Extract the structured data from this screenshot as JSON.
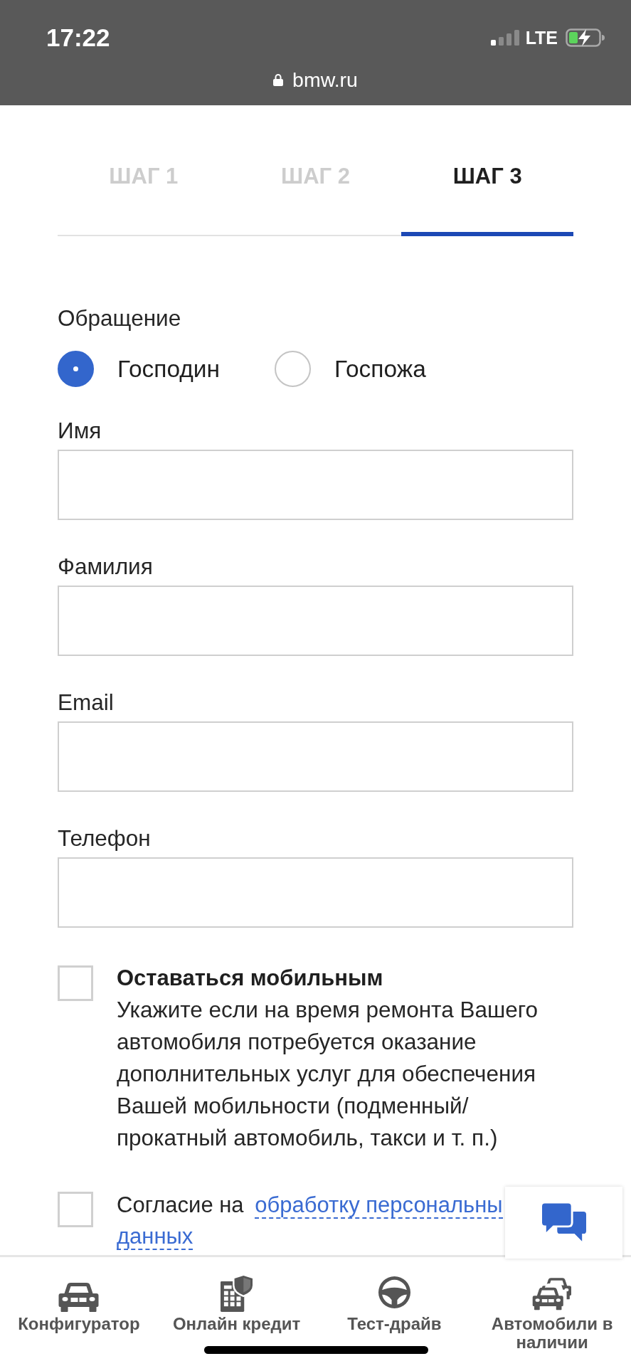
{
  "status_bar": {
    "time": "17:22",
    "network": "LTE"
  },
  "address_bar": {
    "url": "bmw.ru"
  },
  "steps": [
    {
      "label": "ШАГ 1",
      "selected": false
    },
    {
      "label": "ШАГ 2",
      "selected": false
    },
    {
      "label": "ШАГ 3",
      "selected": true
    }
  ],
  "salutation": {
    "label": "Обращение",
    "options": [
      {
        "label": "Господин",
        "selected": true
      },
      {
        "label": "Госпожа",
        "selected": false
      }
    ]
  },
  "fields": [
    {
      "label": "Имя"
    },
    {
      "label": "Фамилия"
    },
    {
      "label": "Email"
    },
    {
      "label": "Телефон"
    }
  ],
  "mobility": {
    "checked": false,
    "title": "Оставаться мобильным",
    "description": "Укажите если на время ремонта Вашего автомобиля потребуется оказание дополнительных услуг для обеспечения Вашей мобильности (подменный/ прокатный автомобиль, такси и т. п.)"
  },
  "consent": {
    "checked": false,
    "text": "Согласие на",
    "link_lines": [
      "обработку персональны",
      "данных"
    ]
  },
  "bottom_nav": [
    {
      "kind": "car",
      "label": "Конфигуратор"
    },
    {
      "kind": "credit",
      "label": "Онлайн кредит"
    },
    {
      "kind": "wheel",
      "label": "Тест-драйв"
    },
    {
      "kind": "cars",
      "label": "Автомобили в наличии"
    }
  ]
}
